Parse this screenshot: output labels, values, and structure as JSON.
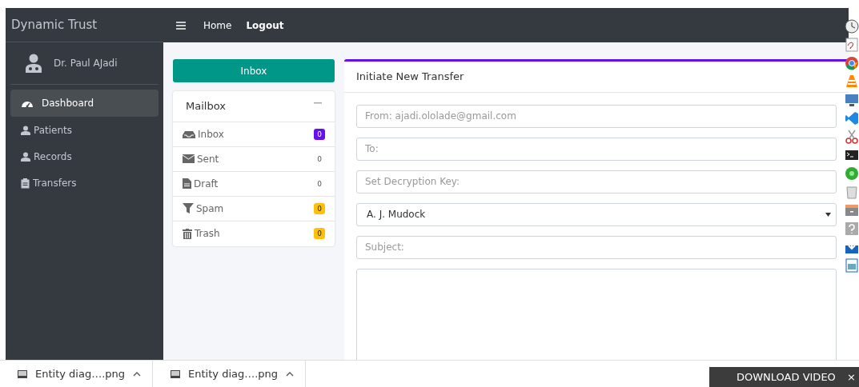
{
  "sidebar": {
    "brand": "Dynamic Trust",
    "user": "Dr. Paul AJadi",
    "items": [
      {
        "label": "Dashboard",
        "selected": true
      },
      {
        "label": "Patients",
        "selected": false
      },
      {
        "label": "Records",
        "selected": false
      },
      {
        "label": "Transfers",
        "selected": false
      }
    ]
  },
  "navbar": {
    "links": [
      "Home",
      "Logout"
    ]
  },
  "inbox_button": "Inbox",
  "mailbox": {
    "title": "Mailbox",
    "items": [
      {
        "label": "Inbox",
        "count": "0",
        "color": "#6610f2"
      },
      {
        "label": "Sent",
        "count": "0"
      },
      {
        "label": "Draft",
        "count": "0"
      },
      {
        "label": "Spam",
        "count": "0",
        "color": "#ffc107"
      },
      {
        "label": "Trash",
        "count": "0",
        "color": "#ffc107"
      }
    ]
  },
  "compose": {
    "title": "Initiate New Transfer",
    "fields": [
      {
        "kind": "input",
        "placeholder": "From: ajadi.ololade@gmail.com"
      },
      {
        "kind": "input",
        "placeholder": "To:"
      },
      {
        "kind": "input",
        "placeholder": "Set Decryption Key:"
      },
      {
        "kind": "select",
        "value": "A. J. Mudock"
      },
      {
        "kind": "input",
        "placeholder": "Subject:"
      },
      {
        "kind": "textarea"
      }
    ]
  },
  "downloads": [
    {
      "name": "Entity diag….png"
    },
    {
      "name": "Entity diag….png"
    }
  ],
  "download_video": {
    "label": "DOWNLOAD VIDEO",
    "close": "×"
  }
}
